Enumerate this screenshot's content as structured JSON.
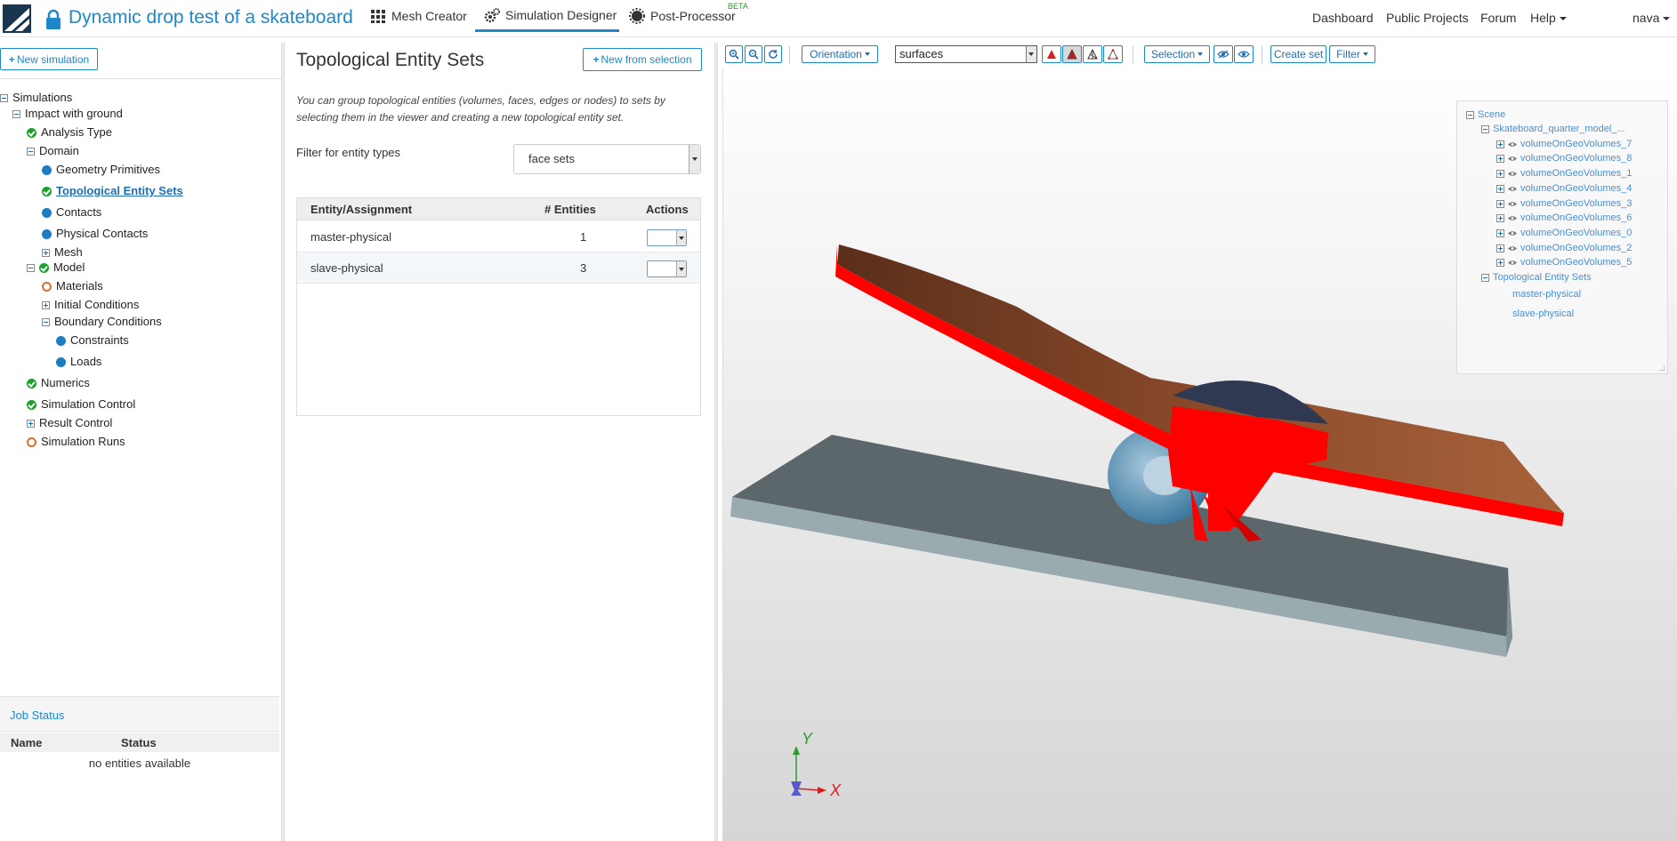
{
  "app": {
    "title": "Dynamic drop test of a skateboard",
    "nav": {
      "mesh_creator": "Mesh Creator",
      "simulation_designer": "Simulation Designer",
      "post_processor": "Post-Processor",
      "beta": "BETA"
    },
    "right_links": {
      "dashboard": "Dashboard",
      "public_projects": "Public Projects",
      "forum": "Forum",
      "help": "Help",
      "user": "nava"
    }
  },
  "sidebar": {
    "new_simulation": "New simulation",
    "tree": {
      "simulations": "Simulations",
      "impact": "Impact with ground",
      "analysis_type": "Analysis Type",
      "domain": "Domain",
      "geometry_primitives": "Geometry Primitives",
      "topological_entity_sets": "Topological Entity Sets",
      "contacts": "Contacts",
      "physical_contacts": "Physical Contacts",
      "mesh": "Mesh",
      "model": "Model",
      "materials": "Materials",
      "initial_conditions": "Initial Conditions",
      "boundary_conditions": "Boundary Conditions",
      "constraints": "Constraints",
      "loads": "Loads",
      "numerics": "Numerics",
      "simulation_control": "Simulation Control",
      "result_control": "Result Control",
      "simulation_runs": "Simulation Runs"
    },
    "job_status": {
      "title": "Job Status",
      "col_name": "Name",
      "col_status": "Status",
      "empty": "no entities available"
    }
  },
  "middle": {
    "title": "Topological Entity Sets",
    "new_from_selection": "New from selection",
    "description": "You can group topological entities (volumes, faces, edges or nodes) to sets by selecting them in the viewer and creating a new topological entity set.",
    "filter_label": "Filter for entity types",
    "filter_value": "face sets",
    "table": {
      "headers": {
        "entity": "Entity/Assignment",
        "count": "# Entities",
        "actions": "Actions"
      },
      "rows": [
        {
          "name": "master-physical",
          "count": "1"
        },
        {
          "name": "slave-physical",
          "count": "3"
        }
      ]
    }
  },
  "viewer": {
    "toolbar": {
      "orientation": "Orientation",
      "render_mode": "surfaces",
      "selection": "Selection",
      "create_set": "Create set",
      "filter": "Filter"
    },
    "scene": {
      "root": "Scene",
      "model": "Skateboard_quarter_model_...",
      "volumes": [
        "volumeOnGeoVolumes_7",
        "volumeOnGeoVolumes_8",
        "volumeOnGeoVolumes_1",
        "volumeOnGeoVolumes_4",
        "volumeOnGeoVolumes_3",
        "volumeOnGeoVolumes_6",
        "volumeOnGeoVolumes_0",
        "volumeOnGeoVolumes_2",
        "volumeOnGeoVolumes_5"
      ],
      "tes_group": "Topological Entity Sets",
      "tes_items": [
        "master-physical",
        "slave-physical"
      ]
    },
    "axis": {
      "y": "Y",
      "x": "X"
    }
  },
  "colors": {
    "accent": "#1e88c8",
    "ok": "#1aa32a",
    "highlight_red": "#ff0000",
    "board_brown": "#8a4a2a",
    "ground": "#5f6b70"
  }
}
